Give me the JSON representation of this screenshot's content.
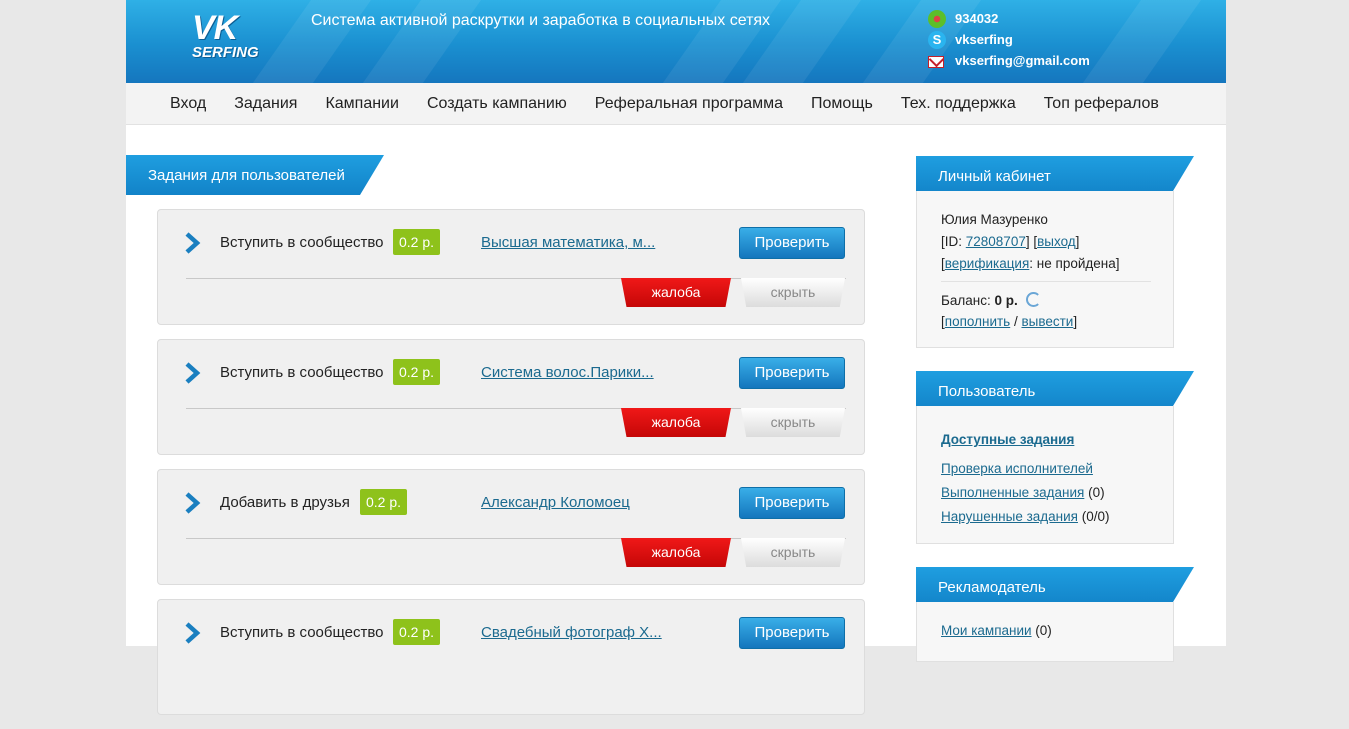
{
  "header": {
    "logo_top": "VK",
    "logo_bottom": "SERFING",
    "tagline": "Система активной раскрутки и заработка в социальных сетях",
    "icq": "934032",
    "skype": "vkserfing",
    "email": "vkserfing@gmail.com"
  },
  "nav": [
    "Вход",
    "Задания",
    "Кампании",
    "Создать кампанию",
    "Реферальная программа",
    "Помощь",
    "Тех. поддержка",
    "Топ рефералов"
  ],
  "main": {
    "section_title": "Задания для пользователей",
    "check_label": "Проверить",
    "complain_label": "жалоба",
    "hide_label": "скрыть",
    "tasks": [
      {
        "name": "Вступить в сообщество",
        "price": "0.2 р.",
        "link": "Высшая математика, м..."
      },
      {
        "name": "Вступить в сообщество",
        "price": "0.2 р.",
        "link": "Система волос.Парики..."
      },
      {
        "name": "Добавить в друзья",
        "price": "0.2 р.",
        "link": "Александр Коломоец"
      },
      {
        "name": "Вступить в сообщество",
        "price": "0.2 р.",
        "link": "Свадебный фотограф Х..."
      }
    ]
  },
  "sidebar": {
    "cabinet": {
      "title": "Личный кабинет",
      "user_name": "Юлия Мазуренко",
      "id_prefix": "[ID: ",
      "id_value": "72808707",
      "id_suffix": "] [",
      "logout": "выход",
      "bracket_close": "]",
      "bracket_open": "[",
      "verification": "верификация",
      "verification_status": ": не пройдена]",
      "balance_label": "Баланс: ",
      "balance_value": "0 р.",
      "topup": "пополнить",
      "slash": " / ",
      "withdraw": "вывести"
    },
    "user": {
      "title": "Пользователь",
      "available": "Доступные задания",
      "check_performers": "Проверка исполнителей",
      "completed": "Выполненные задания",
      "completed_count": " (0)",
      "violated": "Нарушенные задания",
      "violated_count": " (0/0)"
    },
    "advertiser": {
      "title": "Рекламодатель",
      "my_campaigns": "Мои кампании",
      "campaigns_count": " (0)"
    }
  }
}
